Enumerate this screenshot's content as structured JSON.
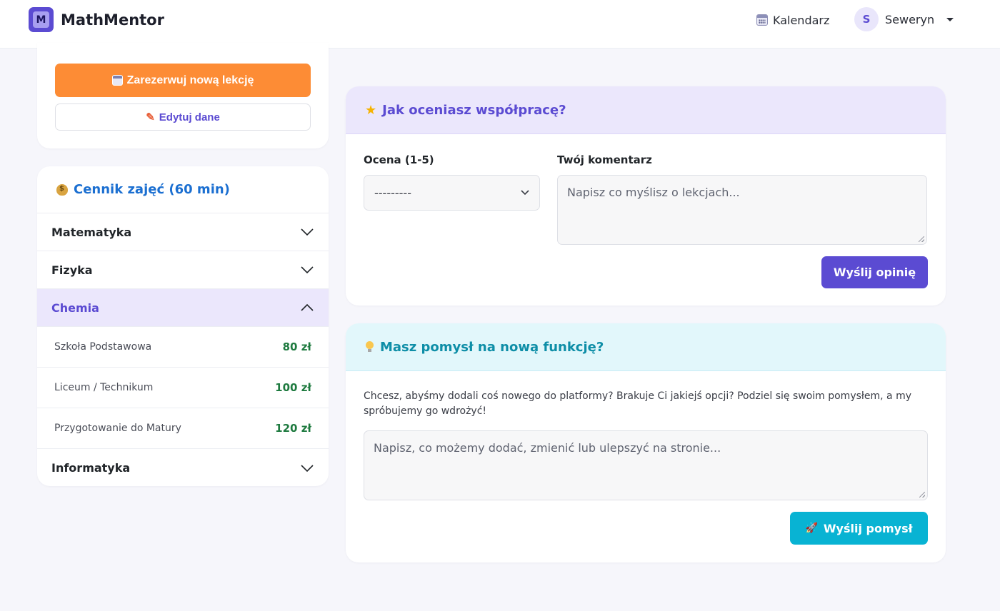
{
  "app": {
    "logo_letter": "M",
    "brand": "MathMentor"
  },
  "nav": {
    "calendar_label": "Kalendarz",
    "user_initial": "S",
    "user_name": "Seweryn"
  },
  "actions": {
    "reserve_label": "Zarezerwuj nową lekcję",
    "edit_label": "Edytuj dane"
  },
  "pricing": {
    "title": "Cennik zajęć (60 min)",
    "subjects": [
      {
        "label": "Matematyka",
        "expanded": false
      },
      {
        "label": "Fizyka",
        "expanded": false
      },
      {
        "label": "Chemia",
        "expanded": true,
        "rows": [
          {
            "label": "Szkoła Podstawowa",
            "price": "80 zł"
          },
          {
            "label": "Liceum / Technikum",
            "price": "100 zł"
          },
          {
            "label": "Przygotowanie do Matury",
            "price": "120 zł"
          }
        ]
      },
      {
        "label": "Informatyka",
        "expanded": false
      }
    ]
  },
  "rating": {
    "title": "Jak oceniasz współpracę?",
    "score_label": "Ocena (1-5)",
    "score_value": "---------",
    "comment_label": "Twój komentarz",
    "comment_placeholder": "Napisz co myślisz o lekcjach...",
    "submit_label": "Wyślij opinię"
  },
  "idea": {
    "title": "Masz pomysł na nową funkcję?",
    "description": "Chcesz, abyśmy dodali coś nowego do platformy? Brakuje Ci jakiejś opcji? Podziel się swoim pomysłem, a my spróbujemy go wdrożyć!",
    "placeholder": "Napisz, co możemy dodać, zmienić lub ulepszyć na stronie...",
    "submit_label": "Wyślij pomysł"
  },
  "colors": {
    "primary": "#5b4bd2",
    "orange": "#fd8c35",
    "cyan": "#08b3d3",
    "price_green": "#1e7a3f",
    "pricing_title": "#1b6fd1"
  }
}
